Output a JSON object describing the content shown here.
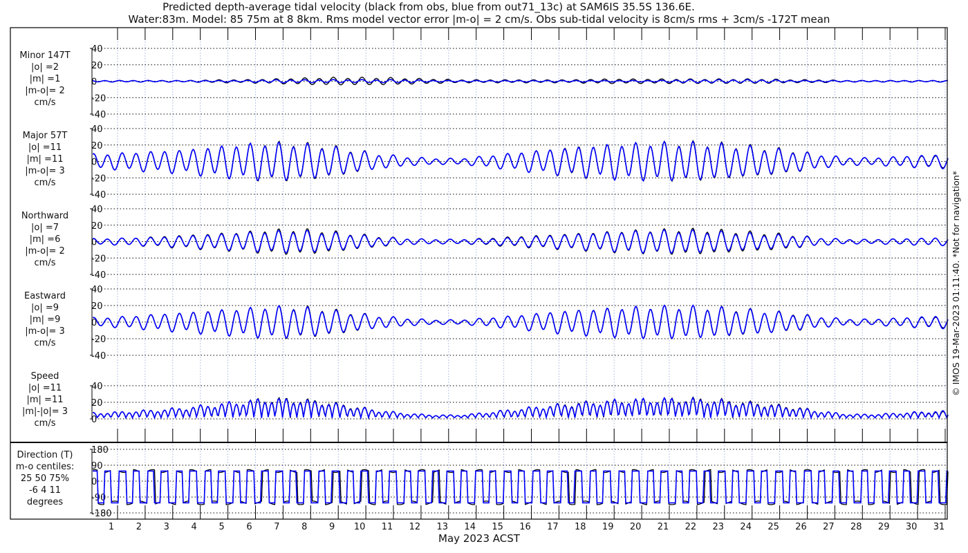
{
  "chart_data": {
    "type": "line",
    "title": [
      "Predicted depth-average tidal velocity (black from obs, blue from out71_13c) at SAM6IS 35.5S 136.6E.",
      "Water:83m. Model: 85 75m at 8 8km. Rms model vector error |m-o| = 2 cm/s. Obs sub-tidal velocity is 8cm/s rms + 3cm/s -172T mean"
    ],
    "xlabel": "May 2023 ACST",
    "x_ticks": [
      "1",
      "2",
      "3",
      "4",
      "5",
      "6",
      "7",
      "8",
      "9",
      "10",
      "11",
      "12",
      "13",
      "14",
      "15",
      "16",
      "17",
      "18",
      "19",
      "20",
      "21",
      "22",
      "23",
      "24",
      "25",
      "26",
      "27",
      "28",
      "29",
      "30",
      "31"
    ],
    "xlim": [
      0.1,
      31.1
    ],
    "series_colors": {
      "obs": "#000000",
      "model": "#0000ff"
    },
    "legend": {
      "obs": "black from obs",
      "model": "blue from out71_13c"
    },
    "copyright": "© IMOS 19-Mar-2023 01:11:40. *Not for navigation*",
    "panels": [
      {
        "key": "minor",
        "label": [
          "Minor 147T",
          "|o| =2",
          "|m| =1",
          "|m-o|= 2",
          "cm/s"
        ],
        "ylim": [
          -40,
          40
        ],
        "yticks": [
          "40",
          "20",
          "0",
          "-20",
          "-40"
        ],
        "obs_daily_amplitude": [
          1,
          1,
          1,
          1,
          2,
          2,
          3,
          4,
          5,
          5,
          5,
          4,
          3,
          2,
          2,
          2,
          2,
          2,
          3,
          3,
          3,
          3,
          3,
          3,
          3,
          2,
          2,
          1,
          1,
          1,
          1
        ],
        "model_daily_amplitude": [
          1,
          1,
          1,
          1,
          1,
          1,
          2,
          2,
          2,
          2,
          2,
          2,
          1,
          1,
          1,
          1,
          1,
          1,
          1,
          1,
          1,
          2,
          2,
          2,
          2,
          1,
          1,
          1,
          1,
          1,
          1
        ]
      },
      {
        "key": "major",
        "label": [
          "Major 57T",
          "|o| =11",
          "|m| =11",
          "|m-o|= 3",
          "cm/s"
        ],
        "ylim": [
          -40,
          40
        ],
        "yticks": [
          "40",
          "20",
          "0",
          "-20",
          "-40"
        ],
        "obs_daily_amplitude": [
          10,
          12,
          14,
          16,
          20,
          23,
          26,
          25,
          22,
          16,
          10,
          6,
          4,
          4,
          8,
          12,
          16,
          20,
          22,
          24,
          25,
          26,
          25,
          22,
          19,
          15,
          9,
          5,
          5,
          7,
          8
        ],
        "model_daily_amplitude": [
          10,
          12,
          14,
          16,
          20,
          23,
          25,
          24,
          21,
          15,
          10,
          6,
          4,
          4,
          8,
          12,
          16,
          19,
          22,
          24,
          25,
          25,
          24,
          21,
          18,
          14,
          9,
          5,
          5,
          7,
          9
        ]
      },
      {
        "key": "northward",
        "label": [
          "Northward",
          "|o| =7",
          "|m| =6",
          "|m-o|= 2",
          "cm/s"
        ],
        "ylim": [
          -40,
          40
        ],
        "yticks": [
          "40",
          "20",
          "0",
          "-20",
          "-40"
        ],
        "obs_daily_amplitude": [
          4,
          5,
          7,
          9,
          11,
          13,
          16,
          17,
          15,
          11,
          7,
          4,
          3,
          3,
          5,
          7,
          9,
          11,
          13,
          15,
          16,
          17,
          16,
          14,
          12,
          9,
          5,
          3,
          3,
          4,
          5
        ],
        "model_daily_amplitude": [
          4,
          5,
          6,
          8,
          10,
          12,
          14,
          15,
          13,
          10,
          6,
          4,
          3,
          3,
          4,
          6,
          8,
          10,
          12,
          14,
          15,
          15,
          14,
          12,
          10,
          8,
          5,
          3,
          3,
          4,
          5
        ]
      },
      {
        "key": "eastward",
        "label": [
          "Eastward",
          "|o| =9",
          "|m| =9",
          "|m-o|= 3",
          "cm/s"
        ],
        "ylim": [
          -40,
          40
        ],
        "yticks": [
          "40",
          "20",
          "0",
          "-20",
          "-40"
        ],
        "obs_daily_amplitude": [
          6,
          8,
          11,
          13,
          16,
          18,
          21,
          21,
          18,
          13,
          8,
          5,
          3,
          3,
          6,
          9,
          13,
          16,
          18,
          20,
          21,
          21,
          20,
          18,
          15,
          12,
          7,
          4,
          4,
          6,
          7
        ],
        "model_daily_amplitude": [
          6,
          8,
          11,
          13,
          16,
          18,
          21,
          20,
          17,
          12,
          8,
          5,
          3,
          3,
          6,
          9,
          13,
          16,
          18,
          20,
          21,
          21,
          20,
          17,
          15,
          11,
          7,
          4,
          4,
          6,
          8
        ]
      },
      {
        "key": "speed",
        "label": [
          "Speed",
          "|o| =11",
          "|m| =11",
          "|m|-|o|= 3",
          "cm/s"
        ],
        "ylim": [
          0,
          40
        ],
        "yticks": [
          "40",
          "20",
          "0"
        ],
        "obs_daily_amplitude": [
          7,
          9,
          11,
          14,
          18,
          22,
          26,
          25,
          22,
          16,
          10,
          6,
          4,
          4,
          8,
          12,
          16,
          20,
          22,
          24,
          25,
          26,
          25,
          22,
          19,
          15,
          9,
          5,
          5,
          7,
          8
        ],
        "model_daily_amplitude": [
          7,
          9,
          11,
          14,
          18,
          22,
          25,
          24,
          21,
          15,
          10,
          6,
          4,
          4,
          8,
          12,
          16,
          19,
          22,
          24,
          25,
          25,
          24,
          21,
          18,
          14,
          9,
          5,
          5,
          7,
          9
        ]
      },
      {
        "key": "direction",
        "label": [
          "Direction (T)",
          "m-o centiles:",
          "25  50  75%",
          "-6   4  11",
          "degrees"
        ],
        "ylim": [
          -180,
          180
        ],
        "yticks": [
          "180",
          "90",
          "0",
          "-90",
          "-180"
        ],
        "flood_direction_deg": 57,
        "ebb_direction_deg": -123
      }
    ]
  }
}
